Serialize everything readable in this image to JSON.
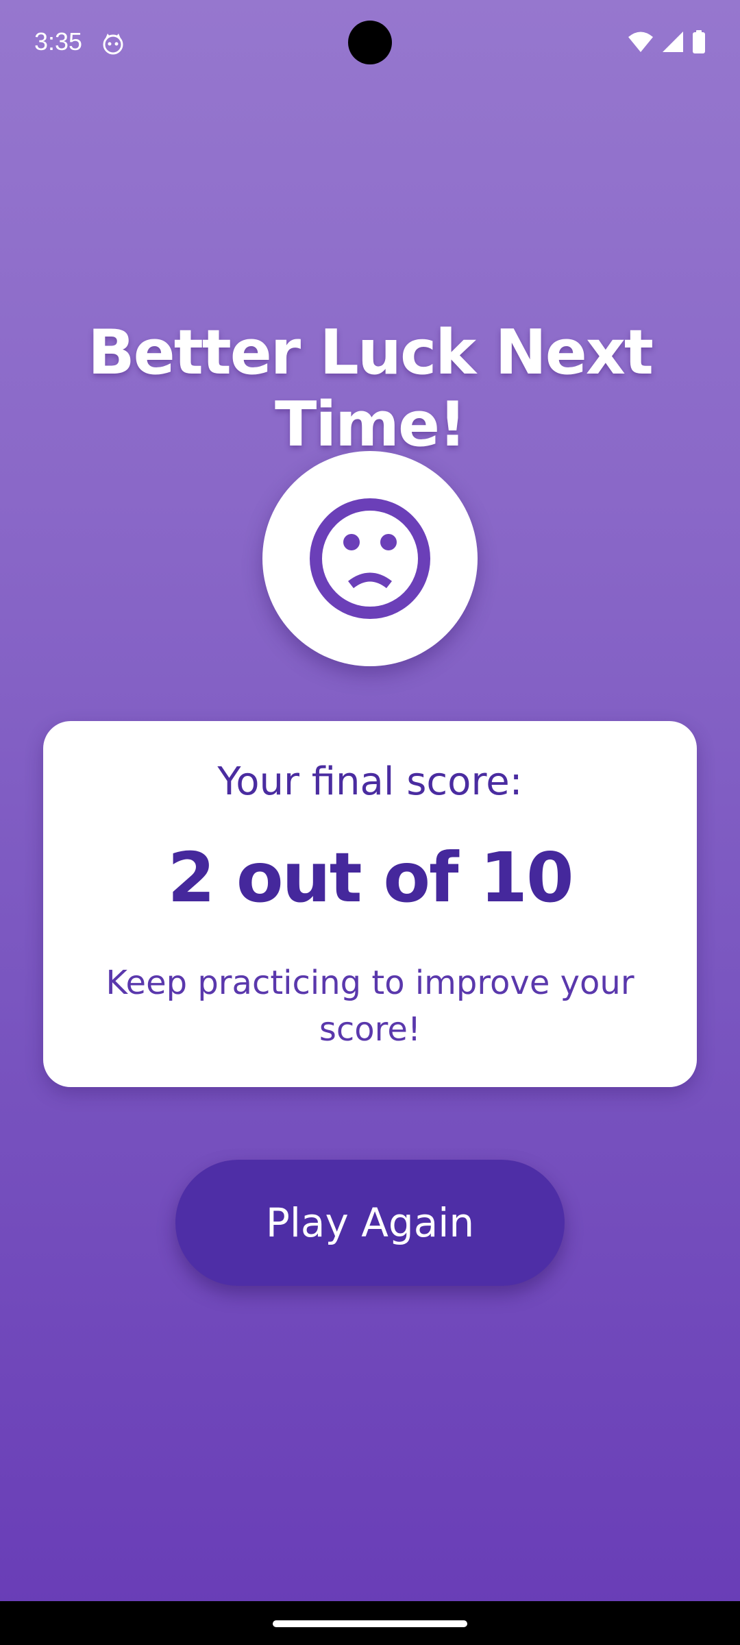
{
  "status_bar": {
    "time": "3:35",
    "app_icon": "cat-face-icon",
    "icons": [
      "wifi-icon",
      "signal-icon",
      "battery-icon"
    ]
  },
  "result": {
    "title": "Better Luck Next Time!",
    "face_icon": "sad-face-icon"
  },
  "score_card": {
    "label": "Your final score:",
    "score": "2 out of 10",
    "message": "Keep practicing to improve your score!"
  },
  "actions": {
    "play_again_label": "Play Again"
  },
  "colors": {
    "background_top": "#9677ce",
    "background_bottom": "#683cb6",
    "accent": "#4e2ea6",
    "card": "#ffffff",
    "text_dark": "#45289c"
  }
}
